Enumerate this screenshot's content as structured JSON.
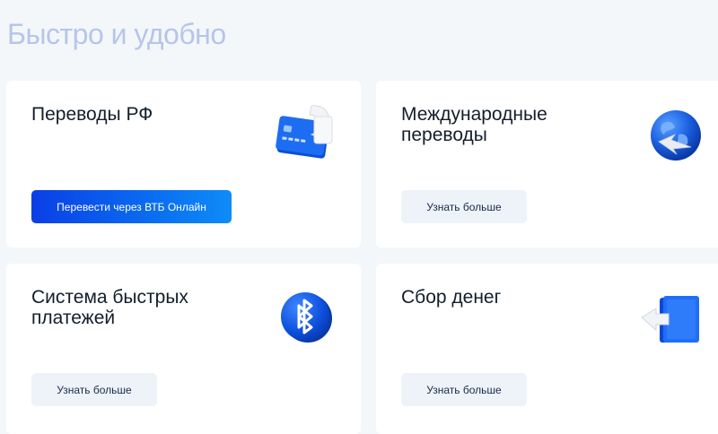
{
  "page": {
    "title": "Быстро и удобно"
  },
  "cards": {
    "rf": {
      "title": "Переводы РФ",
      "button": "Перевести через ВТБ Онлайн",
      "icon": "card-transfer-icon"
    },
    "intl": {
      "title": "Международные переводы",
      "button": "Узнать больше",
      "icon": "globe-icon"
    },
    "sbp": {
      "title": "Система быстрых платежей",
      "button": "Узнать больше",
      "icon": "sbp-icon"
    },
    "collect": {
      "title": "Сбор денег",
      "button": "Узнать больше",
      "icon": "wallet-icon"
    }
  },
  "colors": {
    "background": "#f3f7fa",
    "title": "#b7c5e8",
    "accent_blue": "#0a5cf0",
    "secondary_button": "#eef3f9",
    "text": "#141e2b"
  }
}
